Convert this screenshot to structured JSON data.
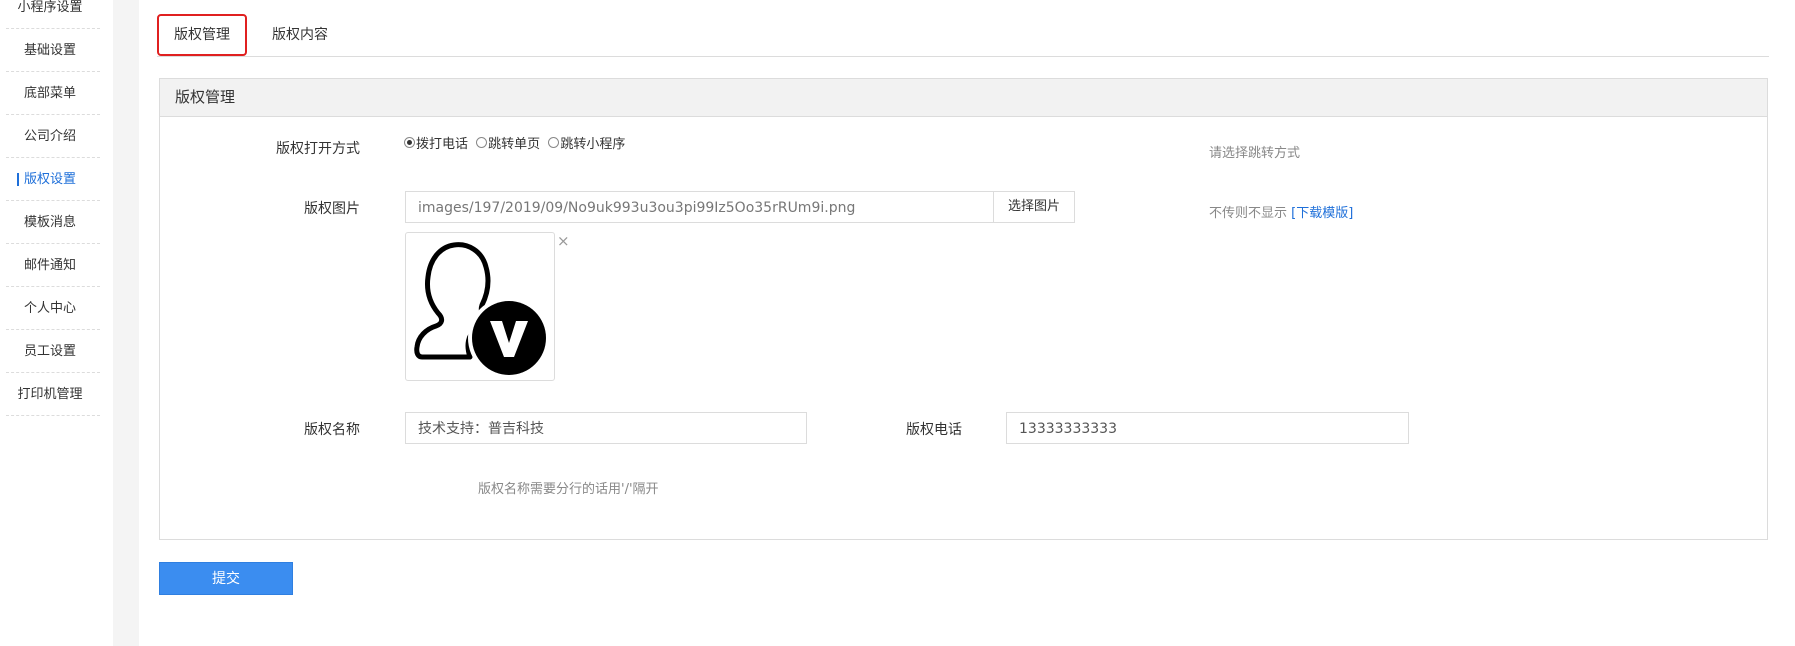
{
  "sidebar": {
    "items": [
      {
        "label": "小程序设置"
      },
      {
        "label": "基础设置"
      },
      {
        "label": "底部菜单"
      },
      {
        "label": "公司介绍"
      },
      {
        "label": "版权设置",
        "active": true
      },
      {
        "label": "模板消息"
      },
      {
        "label": "邮件通知"
      },
      {
        "label": "个人中心"
      },
      {
        "label": "员工设置"
      },
      {
        "label": "打印机管理"
      }
    ]
  },
  "tabs": [
    {
      "label": "版权管理",
      "active": true
    },
    {
      "label": "版权内容"
    }
  ],
  "panel": {
    "title": "版权管理",
    "open_mode": {
      "label": "版权打开方式",
      "options": [
        "拨打电话",
        "跳转单页",
        "跳转小程序"
      ],
      "selected": "拨打电话",
      "hint": "请选择跳转方式"
    },
    "image": {
      "label": "版权图片",
      "value": "images/197/2019/09/No9uk993u3ou3pi99Iz5Oo35rRUm9i.png",
      "button": "选择图片",
      "hint": "不传则不显示",
      "hint_link": "[下载模版]",
      "remove": "×",
      "thumbnail_icon": "user-verified-icon"
    },
    "name": {
      "label": "版权名称",
      "value": "技术支持：普吉科技",
      "hint": "版权名称需要分行的话用'/'隔开"
    },
    "phone": {
      "label": "版权电话",
      "value": "13333333333"
    }
  },
  "submit_label": "提交",
  "colors": {
    "accent": "#1e6fd9",
    "submit": "#3b8df0",
    "tab_highlight": "#e02020"
  }
}
